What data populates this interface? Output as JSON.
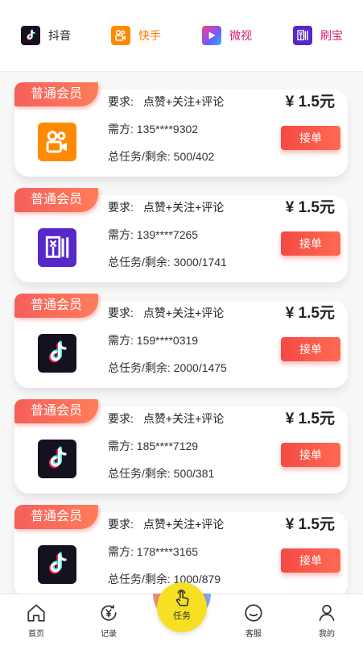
{
  "platforms": [
    {
      "label": "抖音",
      "icon": "douyin-icon",
      "color": "#222222"
    },
    {
      "label": "快手",
      "icon": "kuaishou-icon",
      "color": "#ff7a00"
    },
    {
      "label": "微视",
      "icon": "weishi-icon",
      "color": "#d6196b"
    },
    {
      "label": "刷宝",
      "icon": "shuabao-icon",
      "color": "#d6196b"
    }
  ],
  "tasks": [
    {
      "badge": "普通会员",
      "req_label": "要求:",
      "req_value": "点赞+关注+评论",
      "buyer": "需方: 135****9302",
      "progress": "总任务/剩余: 500/402",
      "price": "¥ 1.5元",
      "button": "接单",
      "app_icon": "kuaishou-icon"
    },
    {
      "badge": "普通会员",
      "req_label": "要求:",
      "req_value": "点赞+关注+评论",
      "buyer": "需方: 139****7265",
      "progress": "总任务/剩余: 3000/1741",
      "price": "¥ 1.5元",
      "button": "接单",
      "app_icon": "shuabao-icon"
    },
    {
      "badge": "普通会员",
      "req_label": "要求:",
      "req_value": "点赞+关注+评论",
      "buyer": "需方: 159****0319",
      "progress": "总任务/剩余: 2000/1475",
      "price": "¥ 1.5元",
      "button": "接单",
      "app_icon": "douyin-icon"
    },
    {
      "badge": "普通会员",
      "req_label": "要求:",
      "req_value": "点赞+关注+评论",
      "buyer": "需方: 185****7129",
      "progress": "总任务/剩余: 500/381",
      "price": "¥ 1.5元",
      "button": "接单",
      "app_icon": "douyin-icon"
    },
    {
      "badge": "普通会员",
      "req_label": "要求:",
      "req_value": "点赞+关注+评论",
      "buyer": "需方: 178****3165",
      "progress": "总任务/剩余: 1000/879",
      "price": "¥ 1.5元",
      "button": "接单",
      "app_icon": "douyin-icon"
    }
  ],
  "nav": {
    "home": "首页",
    "records": "记录",
    "task": "任务",
    "service": "客服",
    "mine": "我的"
  },
  "colors": {
    "accent": "#f55f5b",
    "center_button": "#f7df23"
  }
}
